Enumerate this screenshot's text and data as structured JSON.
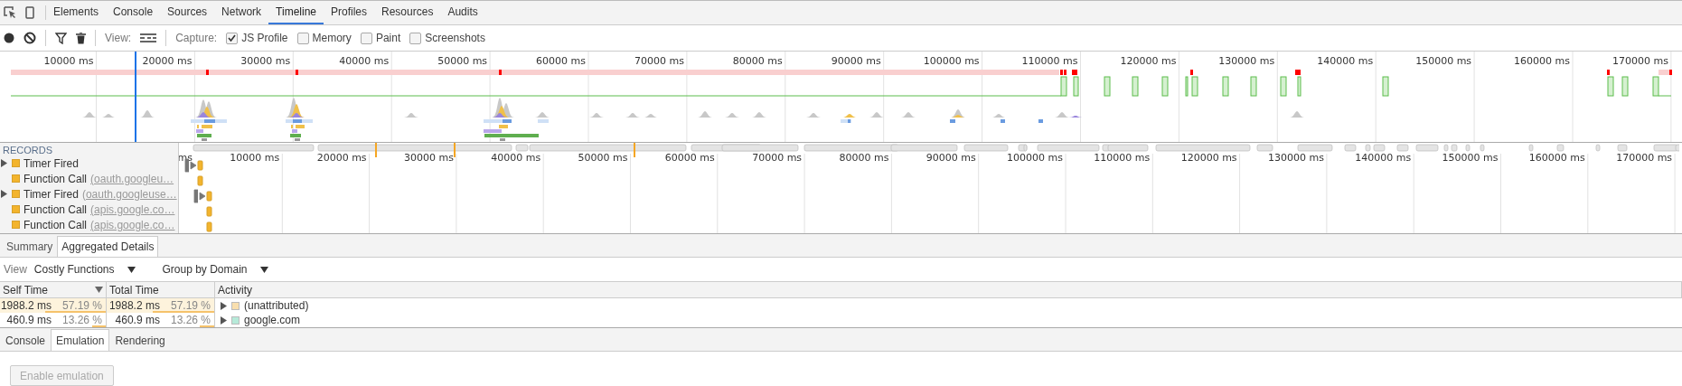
{
  "top_tabs": [
    {
      "label": "Elements",
      "selected": false
    },
    {
      "label": "Console",
      "selected": false
    },
    {
      "label": "Sources",
      "selected": false
    },
    {
      "label": "Network",
      "selected": false
    },
    {
      "label": "Timeline",
      "selected": true
    },
    {
      "label": "Profiles",
      "selected": false
    },
    {
      "label": "Resources",
      "selected": false
    },
    {
      "label": "Audits",
      "selected": false
    }
  ],
  "toolbar": {
    "view_label": "View:",
    "capture_label": "Capture:",
    "options": [
      {
        "label": "JS Profile",
        "checked": true
      },
      {
        "label": "Memory",
        "checked": false
      },
      {
        "label": "Paint",
        "checked": false
      },
      {
        "label": "Screenshots",
        "checked": false
      }
    ]
  },
  "overview": {
    "ticks": [
      "10000 ms",
      "20000 ms",
      "30000 ms",
      "40000 ms",
      "50000 ms",
      "60000 ms",
      "70000 ms",
      "80000 ms",
      "90000 ms",
      "100000 ms",
      "110000 ms",
      "120000 ms",
      "130000 ms",
      "140000 ms",
      "150000 ms",
      "160000 ms",
      "170000 ms"
    ]
  },
  "records": {
    "header": "RECORDS",
    "items": [
      {
        "name": "Timer Fired",
        "expandable": true
      },
      {
        "name": "Function Call",
        "detail": "(oauth.googleu…",
        "expandable": false
      },
      {
        "name": "Timer Fired",
        "detail": "(oauth.googleuse…",
        "expandable": true
      },
      {
        "name": "Function Call",
        "detail": "(apis.google.co…",
        "expandable": false
      },
      {
        "name": "Function Call",
        "detail": "(apis.google.co…",
        "expandable": false
      }
    ],
    "ticks": [
      "ms",
      "10000 ms",
      "20000 ms",
      "30000 ms",
      "40000 ms",
      "50000 ms",
      "60000 ms",
      "70000 ms",
      "80000 ms",
      "90000 ms",
      "100000 ms",
      "110000 ms",
      "120000 ms",
      "130000 ms",
      "140000 ms",
      "150000 ms",
      "160000 ms",
      "170000 ms"
    ]
  },
  "details_tabs": [
    {
      "label": "Summary",
      "selected": false
    },
    {
      "label": "Aggregated Details",
      "selected": true
    }
  ],
  "view_row": {
    "label": "View",
    "dropdowns": [
      "Costly Functions",
      "Group by Domain"
    ]
  },
  "table": {
    "columns": [
      {
        "label": "Self Time",
        "sorted": true
      },
      {
        "label": "Total Time",
        "sorted": false
      },
      {
        "label": "Activity",
        "sorted": false
      }
    ],
    "rows": [
      {
        "self": {
          "time": "1988.2 ms",
          "percent": "57.19 %",
          "level": 0.5719
        },
        "total": {
          "time": "1988.2 ms",
          "percent": "57.19 %",
          "level": 0.5719
        },
        "activity": "(unattributed)",
        "color": "#f9dfae",
        "selected": true
      },
      {
        "self": {
          "time": "460.9 ms",
          "percent": "13.26 %",
          "level": 0.1326
        },
        "total": {
          "time": "460.9 ms",
          "percent": "13.26 %",
          "level": 0.1326
        },
        "activity": "google.com",
        "color": "#b6ead9",
        "selected": false
      }
    ]
  },
  "drawer_tabs": [
    {
      "label": "Console",
      "selected": false
    },
    {
      "label": "Emulation",
      "selected": true
    },
    {
      "label": "Rendering",
      "selected": false
    }
  ],
  "button": {
    "label": "Enable emulation",
    "disabled": true
  }
}
